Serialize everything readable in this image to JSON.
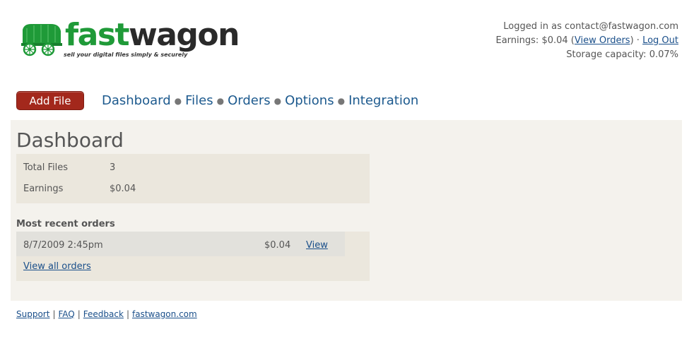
{
  "brand": {
    "name_part1": "fast",
    "name_part2": "wagon",
    "tagline": "sell your digital files simply & securely",
    "logo_icon": "covered-wagon-icon",
    "colors": {
      "green": "#1f9a38",
      "dark": "#2a2a2a"
    }
  },
  "account": {
    "logged_in_prefix": "Logged in as ",
    "email": "contact@fastwagon.com",
    "earnings_prefix": "Earnings: ",
    "earnings_value": "$0.04",
    "view_orders_label": "View Orders",
    "separator": "·",
    "logout_label": "Log Out",
    "storage_label": "Storage capacity: ",
    "storage_value": "0.07%"
  },
  "nav": {
    "add_file_label": "Add File",
    "add_file_color": "#a3281c",
    "items": [
      {
        "label": "Dashboard"
      },
      {
        "label": "Files"
      },
      {
        "label": "Orders"
      },
      {
        "label": "Options"
      },
      {
        "label": "Integration"
      }
    ],
    "separator": "●"
  },
  "main": {
    "title": "Dashboard",
    "stats": [
      {
        "label": "Total Files",
        "value": "3"
      },
      {
        "label": "Earnings",
        "value": "$0.04"
      }
    ],
    "recent_orders_title": "Most recent orders",
    "orders": [
      {
        "date": "8/7/2009 2:45pm",
        "amount": "$0.04",
        "action": "View"
      }
    ],
    "view_all_label": "View all orders"
  },
  "footer": {
    "links": [
      "Support",
      "FAQ",
      "Feedback",
      "fastwagon.com"
    ],
    "separator": "|"
  }
}
